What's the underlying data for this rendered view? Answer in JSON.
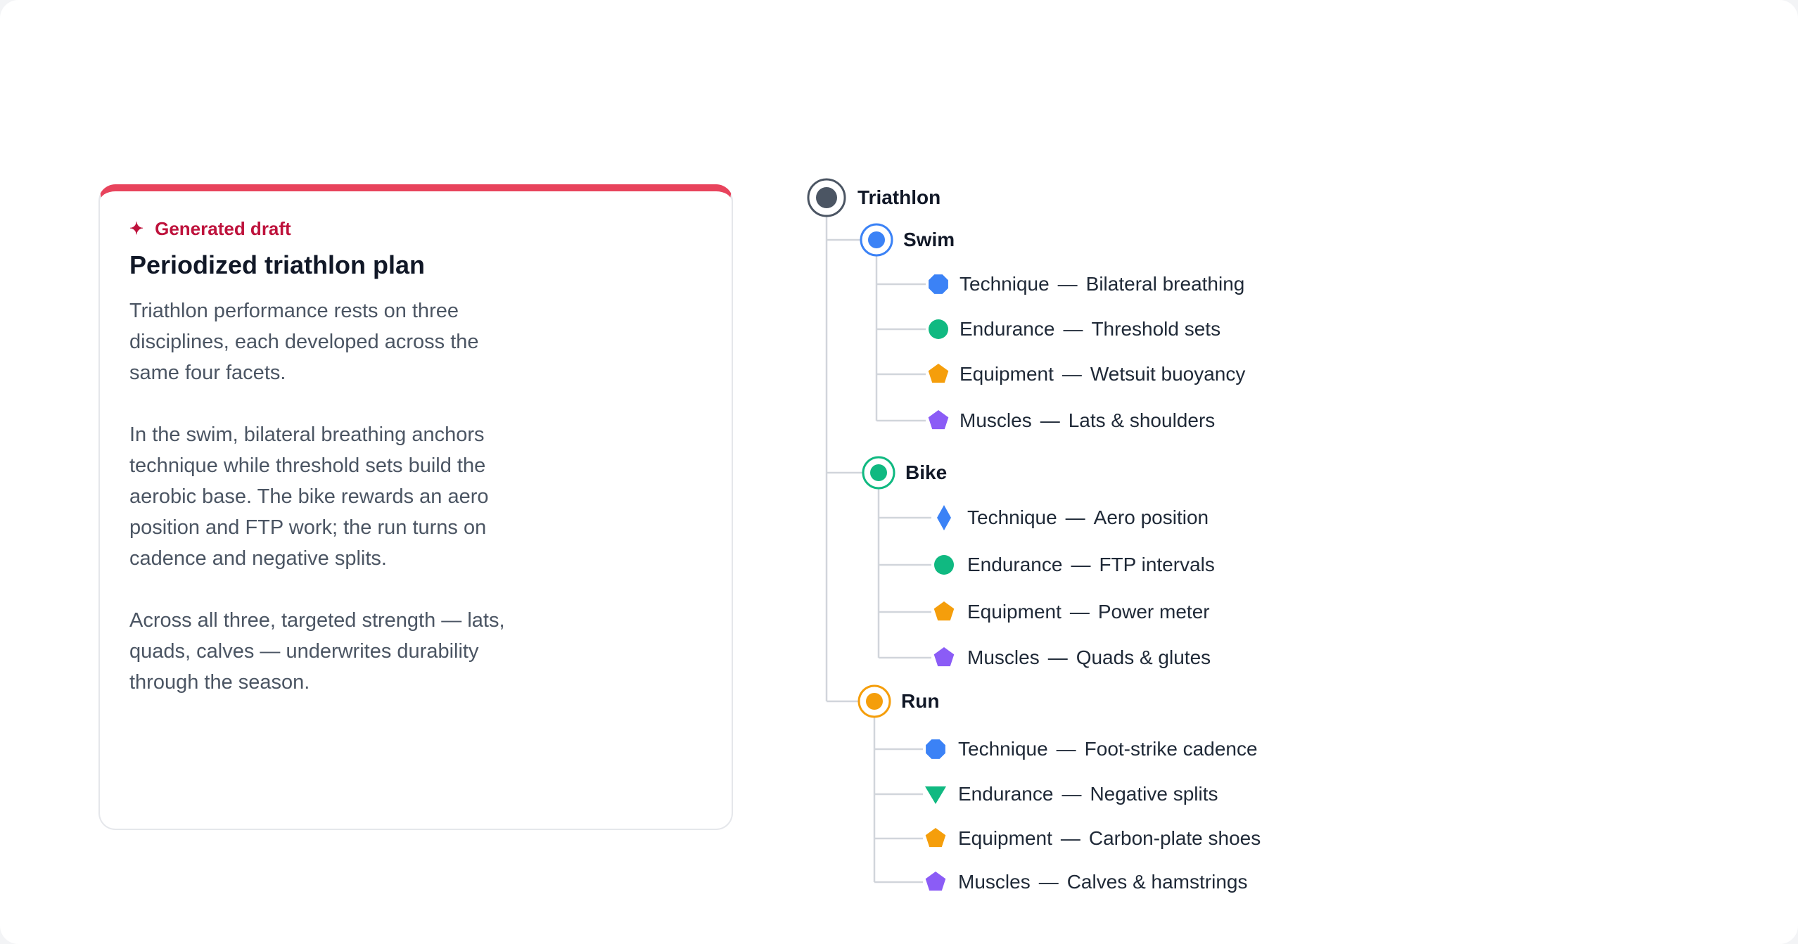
{
  "card": {
    "badge": "Generated draft",
    "title": "Periodized triathlon plan",
    "paragraphs": [
      "Triathlon performance rests on three disciplines, each developed across the same four facets.",
      "In the swim, bilateral breathing anchors technique while threshold sets build the aerobic base. The bike rewards an aero position and FTP work; the run turns on cadence and negative splits.",
      "Across all three, targeted strength — lats, quads, calves — underwrites durability through the season."
    ]
  },
  "tree": {
    "root": {
      "label": "Triathlon",
      "color": "#4b5563"
    },
    "separator": "—",
    "branches": [
      {
        "label": "Swim",
        "color": "#3b82f6",
        "leaves": [
          {
            "facet": "Technique",
            "detail": "Bilateral breathing",
            "shape": "octagon-icon",
            "color": "#3b82f6"
          },
          {
            "facet": "Endurance",
            "detail": "Threshold sets",
            "shape": "circle-icon",
            "color": "#10b981"
          },
          {
            "facet": "Equipment",
            "detail": "Wetsuit buoyancy",
            "shape": "pentagon-icon",
            "color": "#f59e0b"
          },
          {
            "facet": "Muscles",
            "detail": "Lats & shoulders",
            "shape": "pentagon-icon",
            "color": "#8b5cf6"
          }
        ]
      },
      {
        "label": "Bike",
        "color": "#10b981",
        "leaves": [
          {
            "facet": "Technique",
            "detail": "Aero position",
            "shape": "diamond-icon",
            "color": "#3b82f6"
          },
          {
            "facet": "Endurance",
            "detail": "FTP intervals",
            "shape": "circle-icon",
            "color": "#10b981"
          },
          {
            "facet": "Equipment",
            "detail": "Power meter",
            "shape": "pentagon-icon",
            "color": "#f59e0b"
          },
          {
            "facet": "Muscles",
            "detail": "Quads & glutes",
            "shape": "pentagon-icon",
            "color": "#8b5cf6"
          }
        ]
      },
      {
        "label": "Run",
        "color": "#f59e0b",
        "leaves": [
          {
            "facet": "Technique",
            "detail": "Foot-strike cadence",
            "shape": "octagon-icon",
            "color": "#3b82f6"
          },
          {
            "facet": "Endurance",
            "detail": "Negative splits",
            "shape": "triangle-down-icon",
            "color": "#10b981"
          },
          {
            "facet": "Equipment",
            "detail": "Carbon-plate shoes",
            "shape": "pentagon-icon",
            "color": "#f59e0b"
          },
          {
            "facet": "Muscles",
            "detail": "Calves & hamstrings",
            "shape": "pentagon-icon",
            "color": "#8b5cf6"
          }
        ]
      }
    ]
  }
}
